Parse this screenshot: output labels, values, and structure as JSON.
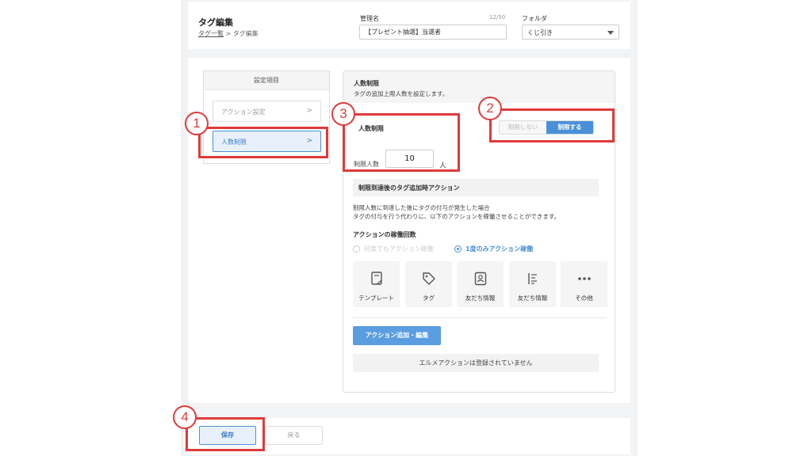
{
  "header": {
    "title": "タグ編集",
    "breadcrumb_link": "タグ一覧",
    "breadcrumb_sep": ">",
    "breadcrumb_current": "タグ編集",
    "name_label": "管理名",
    "name_count": "12/50",
    "name_value": "【プレゼント抽選】当選者",
    "folder_label": "フォルダ",
    "folder_value": "くじ引き"
  },
  "sidebar": {
    "heading": "設定項目",
    "items": [
      {
        "label": "アクション設定",
        "chevron": ">"
      },
      {
        "label": "人数制限",
        "chevron": ">"
      }
    ]
  },
  "content": {
    "title": "人数制限",
    "subtitle": "タグの追加上限人数を設定します。",
    "limit_title": "人数制限",
    "limit_label": "制限人数",
    "limit_value": "10",
    "limit_unit": "人",
    "toggle": {
      "off": "制限しない",
      "on": "制限する"
    },
    "section_title": "制限到達後のタグ追加時アクション",
    "desc_line1": "制限人数に到達した後にタグの付与が発生した場合",
    "desc_line2": "タグの付与を行う代わりに、以下のアクションを稼働させることができます。",
    "count_title": "アクションの稼働回数",
    "radio_any": "何度でもアクション稼働",
    "radio_once": "1度のみアクション稼働",
    "tiles": [
      {
        "label": "テンプレート",
        "icon": "template-icon"
      },
      {
        "label": "タグ",
        "icon": "tag-icon"
      },
      {
        "label": "友だち情報",
        "icon": "contact-card-icon"
      },
      {
        "label": "友だち情報",
        "icon": "list-sort-icon"
      },
      {
        "label": "その他",
        "icon": "more-dots-icon"
      }
    ],
    "add_button": "アクション追加・編集",
    "empty_message": "エルメアクションは登録されていません"
  },
  "footer": {
    "save": "保存",
    "back": "戻る"
  },
  "callouts": [
    "1",
    "2",
    "3",
    "4"
  ],
  "colors": {
    "accent": "#4a90d9",
    "callout": "#e03a3a",
    "background": "#f2f3f5"
  }
}
